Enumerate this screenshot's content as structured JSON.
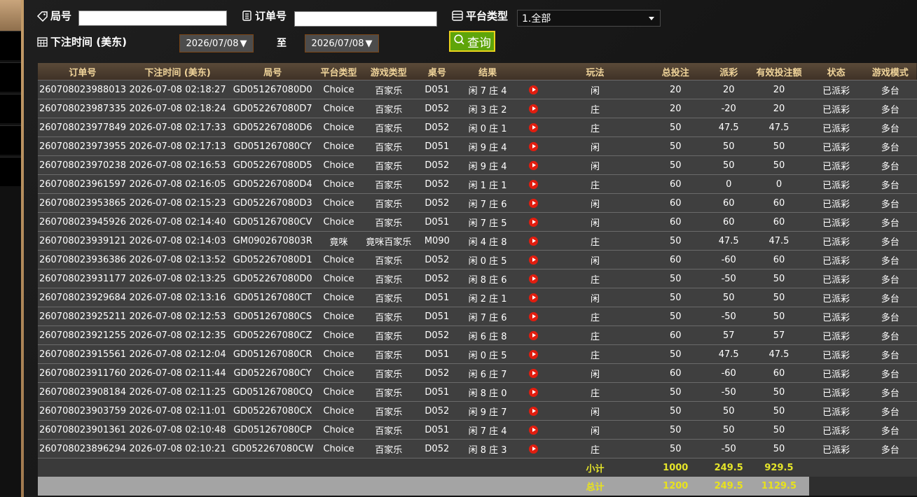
{
  "filters": {
    "round_label": "局号",
    "round_value": "",
    "order_label": "订单号",
    "order_value": "",
    "platform_label": "平台类型",
    "platform_selected": "1.全部",
    "time_label": "下注时间 (美东)",
    "date_from": "2026/07/08",
    "date_to_label": "至",
    "date_to": "2026/07/08",
    "query_label": "查询"
  },
  "table": {
    "headers": [
      "订单号",
      "下注时间 (美东)",
      "局号",
      "平台类型",
      "游戏类型",
      "桌号",
      "结果",
      "玩法",
      "总投注",
      "派彩",
      "有效投注额",
      "状态",
      "游戏模式"
    ],
    "rows": [
      {
        "order": "260708023988013",
        "time": "2026-07-08 02:18:27",
        "round": "GD051267080D0",
        "platform": "Choice",
        "game": "百家乐",
        "table": "D051",
        "result": "闲 7 庄 4",
        "play": "闲",
        "bet": "20",
        "payout": "20",
        "payout_type": "pos",
        "valid": "20",
        "status": "已派彩",
        "mode": "多台"
      },
      {
        "order": "260708023987335",
        "time": "2026-07-08 02:18:24",
        "round": "GD052267080D7",
        "platform": "Choice",
        "game": "百家乐",
        "table": "D052",
        "result": "闲 3 庄 2",
        "play": "庄",
        "bet": "20",
        "payout": "-20",
        "payout_type": "neg",
        "valid": "20",
        "status": "已派彩",
        "mode": "多台"
      },
      {
        "order": "260708023977849",
        "time": "2026-07-08 02:17:33",
        "round": "GD052267080D6",
        "platform": "Choice",
        "game": "百家乐",
        "table": "D052",
        "result": "闲 0 庄 1",
        "play": "庄",
        "bet": "50",
        "payout": "47.5",
        "payout_type": "pos",
        "valid": "47.5",
        "status": "已派彩",
        "mode": "多台"
      },
      {
        "order": "260708023973955",
        "time": "2026-07-08 02:17:13",
        "round": "GD051267080CY",
        "platform": "Choice",
        "game": "百家乐",
        "table": "D051",
        "result": "闲 9 庄 4",
        "play": "闲",
        "bet": "50",
        "payout": "50",
        "payout_type": "pos",
        "valid": "50",
        "status": "已派彩",
        "mode": "多台"
      },
      {
        "order": "260708023970238",
        "time": "2026-07-08 02:16:53",
        "round": "GD052267080D5",
        "platform": "Choice",
        "game": "百家乐",
        "table": "D052",
        "result": "闲 9 庄 4",
        "play": "闲",
        "bet": "50",
        "payout": "50",
        "payout_type": "pos",
        "valid": "50",
        "status": "已派彩",
        "mode": "多台"
      },
      {
        "order": "260708023961597",
        "time": "2026-07-08 02:16:05",
        "round": "GD052267080D4",
        "platform": "Choice",
        "game": "百家乐",
        "table": "D052",
        "result": "闲 1 庄 1",
        "play": "庄",
        "bet": "60",
        "payout": "0",
        "payout_type": "zero",
        "valid": "0",
        "status": "已派彩",
        "mode": "多台"
      },
      {
        "order": "260708023953865",
        "time": "2026-07-08 02:15:23",
        "round": "GD052267080D3",
        "platform": "Choice",
        "game": "百家乐",
        "table": "D052",
        "result": "闲 7 庄 6",
        "play": "闲",
        "bet": "60",
        "payout": "60",
        "payout_type": "pos",
        "valid": "60",
        "status": "已派彩",
        "mode": "多台"
      },
      {
        "order": "260708023945926",
        "time": "2026-07-08 02:14:40",
        "round": "GD051267080CV",
        "platform": "Choice",
        "game": "百家乐",
        "table": "D051",
        "result": "闲 7 庄 5",
        "play": "闲",
        "bet": "60",
        "payout": "60",
        "payout_type": "pos",
        "valid": "60",
        "status": "已派彩",
        "mode": "多台"
      },
      {
        "order": "260708023939121",
        "time": "2026-07-08 02:14:03",
        "round": "GM0902670803R",
        "platform": "竟咪",
        "game": "竟咪百家乐",
        "table": "M090",
        "result": "闲 4 庄 8",
        "play": "庄",
        "bet": "50",
        "payout": "47.5",
        "payout_type": "pos",
        "valid": "47.5",
        "status": "已派彩",
        "mode": "多台"
      },
      {
        "order": "260708023936386",
        "time": "2026-07-08 02:13:52",
        "round": "GD052267080D1",
        "platform": "Choice",
        "game": "百家乐",
        "table": "D052",
        "result": "闲 0 庄 5",
        "play": "闲",
        "bet": "60",
        "payout": "-60",
        "payout_type": "neg",
        "valid": "60",
        "status": "已派彩",
        "mode": "多台"
      },
      {
        "order": "260708023931177",
        "time": "2026-07-08 02:13:25",
        "round": "GD052267080D0",
        "platform": "Choice",
        "game": "百家乐",
        "table": "D052",
        "result": "闲 8 庄 6",
        "play": "庄",
        "bet": "50",
        "payout": "-50",
        "payout_type": "neg",
        "valid": "50",
        "status": "已派彩",
        "mode": "多台"
      },
      {
        "order": "260708023929684",
        "time": "2026-07-08 02:13:16",
        "round": "GD051267080CT",
        "platform": "Choice",
        "game": "百家乐",
        "table": "D051",
        "result": "闲 2 庄 1",
        "play": "闲",
        "bet": "50",
        "payout": "50",
        "payout_type": "pos",
        "valid": "50",
        "status": "已派彩",
        "mode": "多台"
      },
      {
        "order": "260708023925211",
        "time": "2026-07-08 02:12:53",
        "round": "GD051267080CS",
        "platform": "Choice",
        "game": "百家乐",
        "table": "D051",
        "result": "闲 7 庄 6",
        "play": "庄",
        "bet": "50",
        "payout": "-50",
        "payout_type": "neg",
        "valid": "50",
        "status": "已派彩",
        "mode": "多台"
      },
      {
        "order": "260708023921255",
        "time": "2026-07-08 02:12:35",
        "round": "GD052267080CZ",
        "platform": "Choice",
        "game": "百家乐",
        "table": "D052",
        "result": "闲 6 庄 8",
        "play": "庄",
        "bet": "60",
        "payout": "57",
        "payout_type": "pos",
        "valid": "57",
        "status": "已派彩",
        "mode": "多台"
      },
      {
        "order": "260708023915561",
        "time": "2026-07-08 02:12:04",
        "round": "GD051267080CR",
        "platform": "Choice",
        "game": "百家乐",
        "table": "D051",
        "result": "闲 0 庄 5",
        "play": "庄",
        "bet": "50",
        "payout": "47.5",
        "payout_type": "pos",
        "valid": "47.5",
        "status": "已派彩",
        "mode": "多台"
      },
      {
        "order": "260708023911760",
        "time": "2026-07-08 02:11:44",
        "round": "GD052267080CY",
        "platform": "Choice",
        "game": "百家乐",
        "table": "D052",
        "result": "闲 6 庄 7",
        "play": "闲",
        "bet": "60",
        "payout": "-60",
        "payout_type": "neg",
        "valid": "60",
        "status": "已派彩",
        "mode": "多台"
      },
      {
        "order": "260708023908184",
        "time": "2026-07-08 02:11:25",
        "round": "GD051267080CQ",
        "platform": "Choice",
        "game": "百家乐",
        "table": "D051",
        "result": "闲 8 庄 0",
        "play": "庄",
        "bet": "50",
        "payout": "-50",
        "payout_type": "neg",
        "valid": "50",
        "status": "已派彩",
        "mode": "多台"
      },
      {
        "order": "260708023903759",
        "time": "2026-07-08 02:11:01",
        "round": "GD052267080CX",
        "platform": "Choice",
        "game": "百家乐",
        "table": "D052",
        "result": "闲 9 庄 7",
        "play": "闲",
        "bet": "50",
        "payout": "50",
        "payout_type": "pos",
        "valid": "50",
        "status": "已派彩",
        "mode": "多台"
      },
      {
        "order": "260708023901361",
        "time": "2026-07-08 02:10:48",
        "round": "GD051267080CP",
        "platform": "Choice",
        "game": "百家乐",
        "table": "D051",
        "result": "闲 7 庄 4",
        "play": "闲",
        "bet": "50",
        "payout": "50",
        "payout_type": "pos",
        "valid": "50",
        "status": "已派彩",
        "mode": "多台"
      },
      {
        "order": "260708023896294",
        "time": "2026-07-08 02:10:21",
        "round": "GD052267080CW",
        "platform": "Choice",
        "game": "百家乐",
        "table": "D052",
        "result": "闲 8 庄 3",
        "play": "庄",
        "bet": "50",
        "payout": "-50",
        "payout_type": "neg",
        "valid": "50",
        "status": "已派彩",
        "mode": "多台"
      }
    ],
    "subtotal": {
      "label": "小计",
      "bet": "1000",
      "payout": "249.5",
      "valid": "929.5"
    },
    "total": {
      "label": "总计",
      "bet": "1200",
      "payout": "249.5",
      "valid": "1129.5"
    }
  },
  "colors": {
    "accent_gold": "#f0d49a",
    "positive_payout": "#c9102d",
    "negative_payout": "#37d12f",
    "status_green": "#1ed21e",
    "query_green": "#5ea50a",
    "total_yellow": "#e8e21c"
  },
  "icons": {
    "round": "tag-icon",
    "order": "document-icon",
    "platform": "list-icon",
    "time": "calendar-icon",
    "query": "search-icon",
    "replay": "play-icon"
  }
}
